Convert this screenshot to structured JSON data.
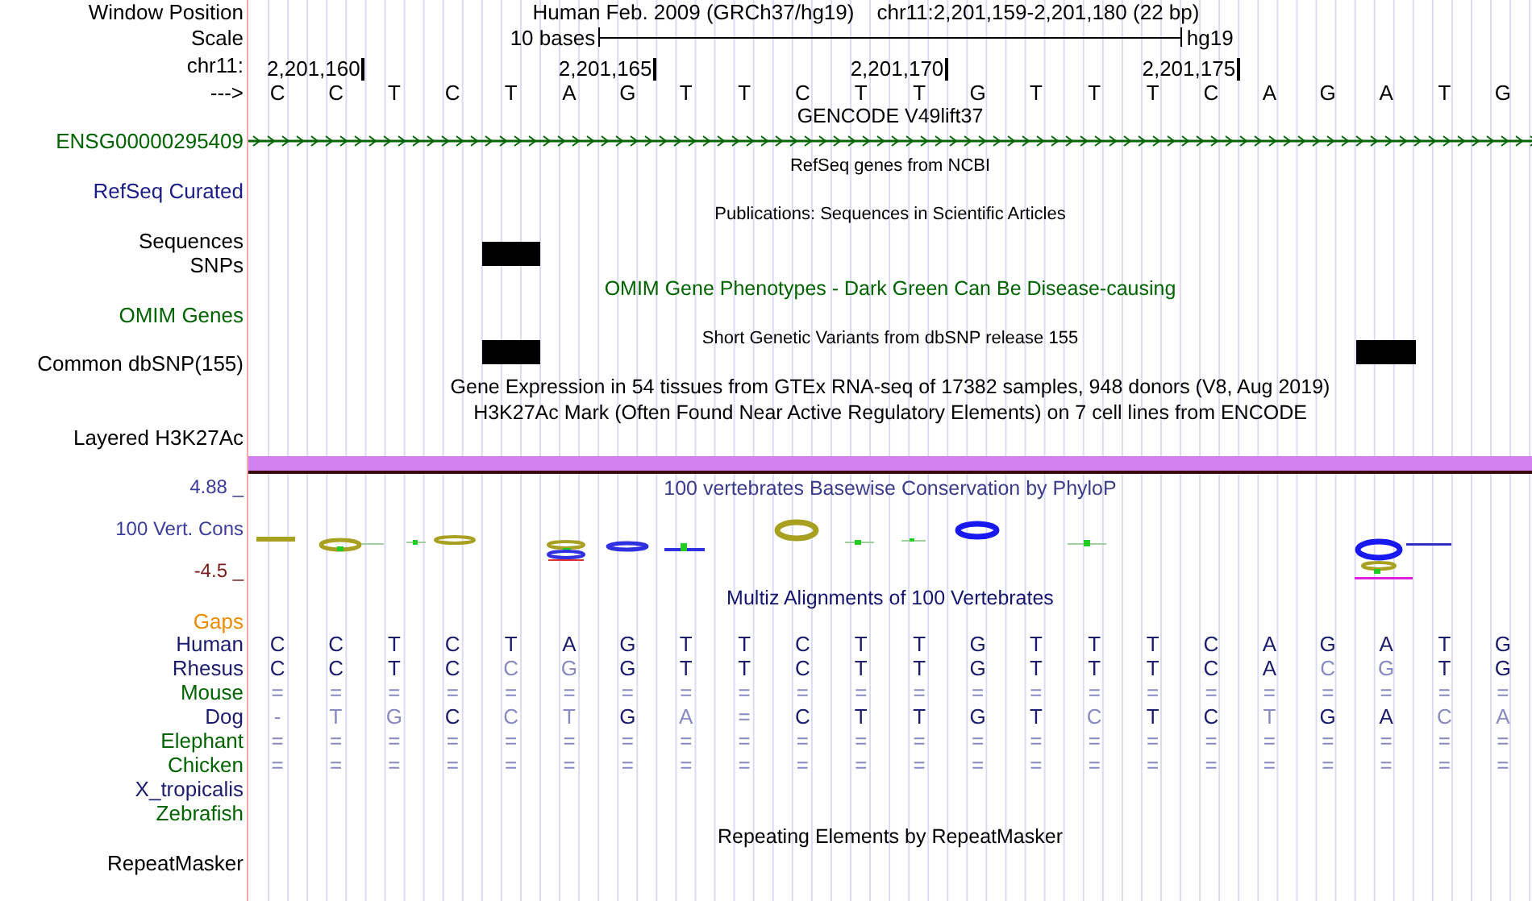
{
  "header": {
    "window_label": "Window Position",
    "genome": "Human Feb. 2009 (GRCh37/hg19)",
    "position": "chr11:2,201,159-2,201,180 (22 bp)",
    "scale_label": "Scale",
    "scale_text": "10 bases",
    "assembly": "hg19",
    "chrom_label": "chr11:",
    "ticks": [
      "2,201,160",
      "2,201,165",
      "2,201,170",
      "2,201,175"
    ],
    "strand_label": "--->",
    "bases": [
      "C",
      "C",
      "T",
      "C",
      "T",
      "A",
      "G",
      "T",
      "T",
      "C",
      "T",
      "T",
      "G",
      "T",
      "T",
      "T",
      "C",
      "A",
      "G",
      "A",
      "T",
      "G"
    ]
  },
  "rows": [
    {
      "kind": "title",
      "text": "GENCODE V49lift37",
      "color": "#000000"
    },
    {
      "kind": "gene",
      "label": "ENSG00000295409",
      "color": "#006400"
    },
    {
      "kind": "note",
      "text": "RefSeq genes from NCBI"
    },
    {
      "kind": "label",
      "label": "RefSeq Curated",
      "color": "#1c1c8a"
    },
    {
      "kind": "note",
      "text": "Publications: Sequences in Scientific Articles"
    },
    {
      "kind": "label",
      "label": "Sequences",
      "color": "#000000"
    },
    {
      "kind": "variants",
      "label": "SNPs",
      "color": "#000000",
      "cells": [
        false,
        false,
        false,
        false,
        true,
        false,
        false,
        false,
        false,
        false,
        false,
        false,
        false,
        false,
        false,
        false,
        false,
        false,
        false,
        false,
        false,
        false
      ]
    },
    {
      "kind": "title",
      "text": "OMIM Gene Phenotypes - Dark Green Can Be Disease-causing",
      "color": "#006400"
    },
    {
      "kind": "label",
      "label": "OMIM Genes",
      "color": "#006400"
    },
    {
      "kind": "note",
      "text": "Short Genetic Variants from dbSNP release 155"
    },
    {
      "kind": "variants",
      "label": "Common dbSNP(155)",
      "color": "#000000",
      "cells": [
        false,
        false,
        false,
        false,
        true,
        false,
        false,
        false,
        false,
        false,
        false,
        false,
        false,
        false,
        false,
        false,
        false,
        false,
        false,
        true,
        false,
        false
      ]
    },
    {
      "kind": "title",
      "text": "Gene Expression in 54 tissues from GTEx RNA-seq of 17382 samples, 948 donors (V8, Aug 2019)",
      "color": "#000000"
    },
    {
      "kind": "title",
      "text": "H3K27Ac Mark (Often Found Near Active Regulatory Elements) on 7 cell lines from ENCODE",
      "color": "#000000"
    },
    {
      "kind": "label",
      "label": "Layered H3K27Ac",
      "color": "#000000"
    },
    {
      "kind": "signal"
    }
  ],
  "conservation": {
    "title": "100 vertebrates Basewise Conservation by PhyloP",
    "label": "100 Vert. Cons",
    "y_max": "4.88 _",
    "y_min": "-4.5 _"
  },
  "alignment": {
    "title": "Multiz Alignments of 100 Vertebrates",
    "gaps_label": "Gaps",
    "species": [
      {
        "name": "Human",
        "color": "#1c1c6e",
        "bases": [
          {
            "b": "C",
            "dim": false
          },
          {
            "b": "C",
            "dim": false
          },
          {
            "b": "T",
            "dim": false
          },
          {
            "b": "C",
            "dim": false
          },
          {
            "b": "T",
            "dim": false
          },
          {
            "b": "A",
            "dim": false
          },
          {
            "b": "G",
            "dim": false
          },
          {
            "b": "T",
            "dim": false
          },
          {
            "b": "T",
            "dim": false
          },
          {
            "b": "C",
            "dim": false
          },
          {
            "b": "T",
            "dim": false
          },
          {
            "b": "T",
            "dim": false
          },
          {
            "b": "G",
            "dim": false
          },
          {
            "b": "T",
            "dim": false
          },
          {
            "b": "T",
            "dim": false
          },
          {
            "b": "T",
            "dim": false
          },
          {
            "b": "C",
            "dim": false
          },
          {
            "b": "A",
            "dim": false
          },
          {
            "b": "G",
            "dim": false
          },
          {
            "b": "A",
            "dim": false
          },
          {
            "b": "T",
            "dim": false
          },
          {
            "b": "G",
            "dim": false
          }
        ]
      },
      {
        "name": "Rhesus",
        "color": "#1c1c6e",
        "bases": [
          {
            "b": "C",
            "dim": false
          },
          {
            "b": "C",
            "dim": false
          },
          {
            "b": "T",
            "dim": false
          },
          {
            "b": "C",
            "dim": false
          },
          {
            "b": "C",
            "dim": true
          },
          {
            "b": "G",
            "dim": true
          },
          {
            "b": "G",
            "dim": false
          },
          {
            "b": "T",
            "dim": false
          },
          {
            "b": "T",
            "dim": false
          },
          {
            "b": "C",
            "dim": false
          },
          {
            "b": "T",
            "dim": false
          },
          {
            "b": "T",
            "dim": false
          },
          {
            "b": "G",
            "dim": false
          },
          {
            "b": "T",
            "dim": false
          },
          {
            "b": "T",
            "dim": false
          },
          {
            "b": "T",
            "dim": false
          },
          {
            "b": "C",
            "dim": false
          },
          {
            "b": "A",
            "dim": false
          },
          {
            "b": "C",
            "dim": true
          },
          {
            "b": "G",
            "dim": true
          },
          {
            "b": "T",
            "dim": false
          },
          {
            "b": "G",
            "dim": false
          }
        ]
      },
      {
        "name": "Mouse",
        "color": "#006400",
        "bases": [
          {
            "b": "=",
            "dim": true
          },
          {
            "b": "=",
            "dim": true
          },
          {
            "b": "=",
            "dim": true
          },
          {
            "b": "=",
            "dim": true
          },
          {
            "b": "=",
            "dim": true
          },
          {
            "b": "=",
            "dim": true
          },
          {
            "b": "=",
            "dim": true
          },
          {
            "b": "=",
            "dim": true
          },
          {
            "b": "=",
            "dim": true
          },
          {
            "b": "=",
            "dim": true
          },
          {
            "b": "=",
            "dim": true
          },
          {
            "b": "=",
            "dim": true
          },
          {
            "b": "=",
            "dim": true
          },
          {
            "b": "=",
            "dim": true
          },
          {
            "b": "=",
            "dim": true
          },
          {
            "b": "=",
            "dim": true
          },
          {
            "b": "=",
            "dim": true
          },
          {
            "b": "=",
            "dim": true
          },
          {
            "b": "=",
            "dim": true
          },
          {
            "b": "=",
            "dim": true
          },
          {
            "b": "=",
            "dim": true
          },
          {
            "b": "=",
            "dim": true
          }
        ]
      },
      {
        "name": "Dog",
        "color": "#1c1c6e",
        "bases": [
          {
            "b": "-",
            "dim": true
          },
          {
            "b": "T",
            "dim": true
          },
          {
            "b": "G",
            "dim": true
          },
          {
            "b": "C",
            "dim": false
          },
          {
            "b": "C",
            "dim": true
          },
          {
            "b": "T",
            "dim": true
          },
          {
            "b": "G",
            "dim": false
          },
          {
            "b": "A",
            "dim": true
          },
          {
            "b": "=",
            "dim": true
          },
          {
            "b": "C",
            "dim": false
          },
          {
            "b": "T",
            "dim": false
          },
          {
            "b": "T",
            "dim": false
          },
          {
            "b": "G",
            "dim": false
          },
          {
            "b": "T",
            "dim": false
          },
          {
            "b": "C",
            "dim": true
          },
          {
            "b": "T",
            "dim": false
          },
          {
            "b": "C",
            "dim": false
          },
          {
            "b": "T",
            "dim": true
          },
          {
            "b": "G",
            "dim": false
          },
          {
            "b": "A",
            "dim": false
          },
          {
            "b": "C",
            "dim": true
          },
          {
            "b": "A",
            "dim": true
          }
        ]
      },
      {
        "name": "Elephant",
        "color": "#006400",
        "bases": [
          {
            "b": "=",
            "dim": true
          },
          {
            "b": "=",
            "dim": true
          },
          {
            "b": "=",
            "dim": true
          },
          {
            "b": "=",
            "dim": true
          },
          {
            "b": "=",
            "dim": true
          },
          {
            "b": "=",
            "dim": true
          },
          {
            "b": "=",
            "dim": true
          },
          {
            "b": "=",
            "dim": true
          },
          {
            "b": "=",
            "dim": true
          },
          {
            "b": "=",
            "dim": true
          },
          {
            "b": "=",
            "dim": true
          },
          {
            "b": "=",
            "dim": true
          },
          {
            "b": "=",
            "dim": true
          },
          {
            "b": "=",
            "dim": true
          },
          {
            "b": "=",
            "dim": true
          },
          {
            "b": "=",
            "dim": true
          },
          {
            "b": "=",
            "dim": true
          },
          {
            "b": "=",
            "dim": true
          },
          {
            "b": "=",
            "dim": true
          },
          {
            "b": "=",
            "dim": true
          },
          {
            "b": "=",
            "dim": true
          },
          {
            "b": "=",
            "dim": true
          }
        ]
      },
      {
        "name": "Chicken",
        "color": "#006400",
        "bases": [
          {
            "b": "=",
            "dim": true
          },
          {
            "b": "=",
            "dim": true
          },
          {
            "b": "=",
            "dim": true
          },
          {
            "b": "=",
            "dim": true
          },
          {
            "b": "=",
            "dim": true
          },
          {
            "b": "=",
            "dim": true
          },
          {
            "b": "=",
            "dim": true
          },
          {
            "b": "=",
            "dim": true
          },
          {
            "b": "=",
            "dim": true
          },
          {
            "b": "=",
            "dim": true
          },
          {
            "b": "=",
            "dim": true
          },
          {
            "b": "=",
            "dim": true
          },
          {
            "b": "=",
            "dim": true
          },
          {
            "b": "=",
            "dim": true
          },
          {
            "b": "=",
            "dim": true
          },
          {
            "b": "=",
            "dim": true
          },
          {
            "b": "=",
            "dim": true
          },
          {
            "b": "=",
            "dim": true
          },
          {
            "b": "=",
            "dim": true
          },
          {
            "b": "=",
            "dim": true
          },
          {
            "b": "=",
            "dim": true
          },
          {
            "b": "=",
            "dim": true
          }
        ]
      },
      {
        "name": "X_tropicalis",
        "color": "#1c1c6e"
      },
      {
        "name": "Zebrafish",
        "color": "#006400"
      }
    ]
  },
  "repeats": {
    "title": "Repeating Elements by RepeatMasker",
    "label": "RepeatMasker"
  }
}
